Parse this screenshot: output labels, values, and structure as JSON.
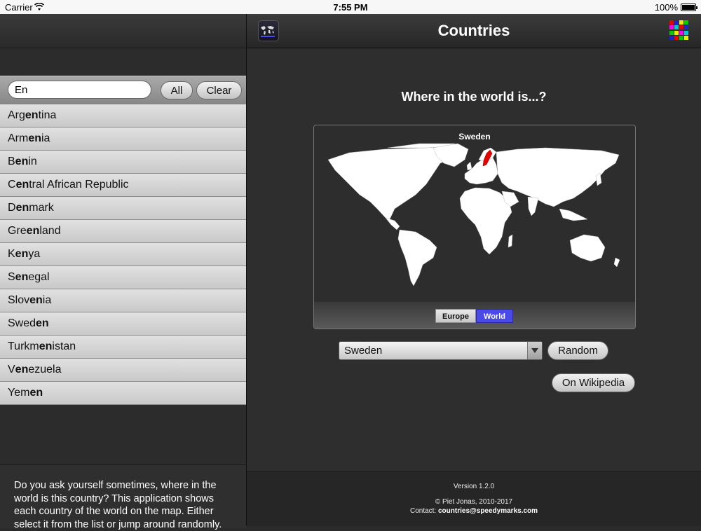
{
  "statusbar": {
    "carrier": "Carrier",
    "time": "7:55 PM",
    "battery": "100%"
  },
  "header": {
    "title": "Countries"
  },
  "search": {
    "value": "En",
    "all_label": "All",
    "clear_label": "Clear"
  },
  "countries": [
    {
      "pre": "Arg",
      "match": "en",
      "post": "tina"
    },
    {
      "pre": "Arm",
      "match": "en",
      "post": "ia"
    },
    {
      "pre": "B",
      "match": "en",
      "post": "in"
    },
    {
      "pre": "C",
      "match": "en",
      "post": "tral African Republic"
    },
    {
      "pre": "D",
      "match": "en",
      "post": "mark"
    },
    {
      "pre": "Gre",
      "match": "en",
      "post": "land"
    },
    {
      "pre": "K",
      "match": "en",
      "post": "ya"
    },
    {
      "pre": "S",
      "match": "en",
      "post": "egal"
    },
    {
      "pre": "Slov",
      "match": "en",
      "post": "ia"
    },
    {
      "pre": "Swed",
      "match": "en",
      "post": ""
    },
    {
      "pre": "Turkm",
      "match": "en",
      "post": "istan"
    },
    {
      "pre": "V",
      "match": "en",
      "post": "ezuela"
    },
    {
      "pre": "Yem",
      "match": "en",
      "post": ""
    }
  ],
  "description": "Do you ask yourself sometimes, where in the world is this country? This application shows each country of the world on the map. Either select it from the list or jump around randomly.",
  "main": {
    "question": "Where in the world is...?",
    "map_label": "Sweden",
    "seg_europe": "Europe",
    "seg_world": "World",
    "selected_country": "Sweden",
    "random_label": "Random",
    "wiki_label": "On Wikipedia"
  },
  "footer": {
    "version": "Version 1.2.0",
    "copyright": "© Piet Jonas, 2010-2017",
    "contact_label": "Contact:",
    "contact_email": "countries@speedymarks.com"
  },
  "colors": {
    "highlight": "#e60000",
    "segment_active": "#4a4ae6"
  },
  "icons": {
    "map_button": "world-map-icon",
    "grid_button": "color-grid-icon"
  }
}
